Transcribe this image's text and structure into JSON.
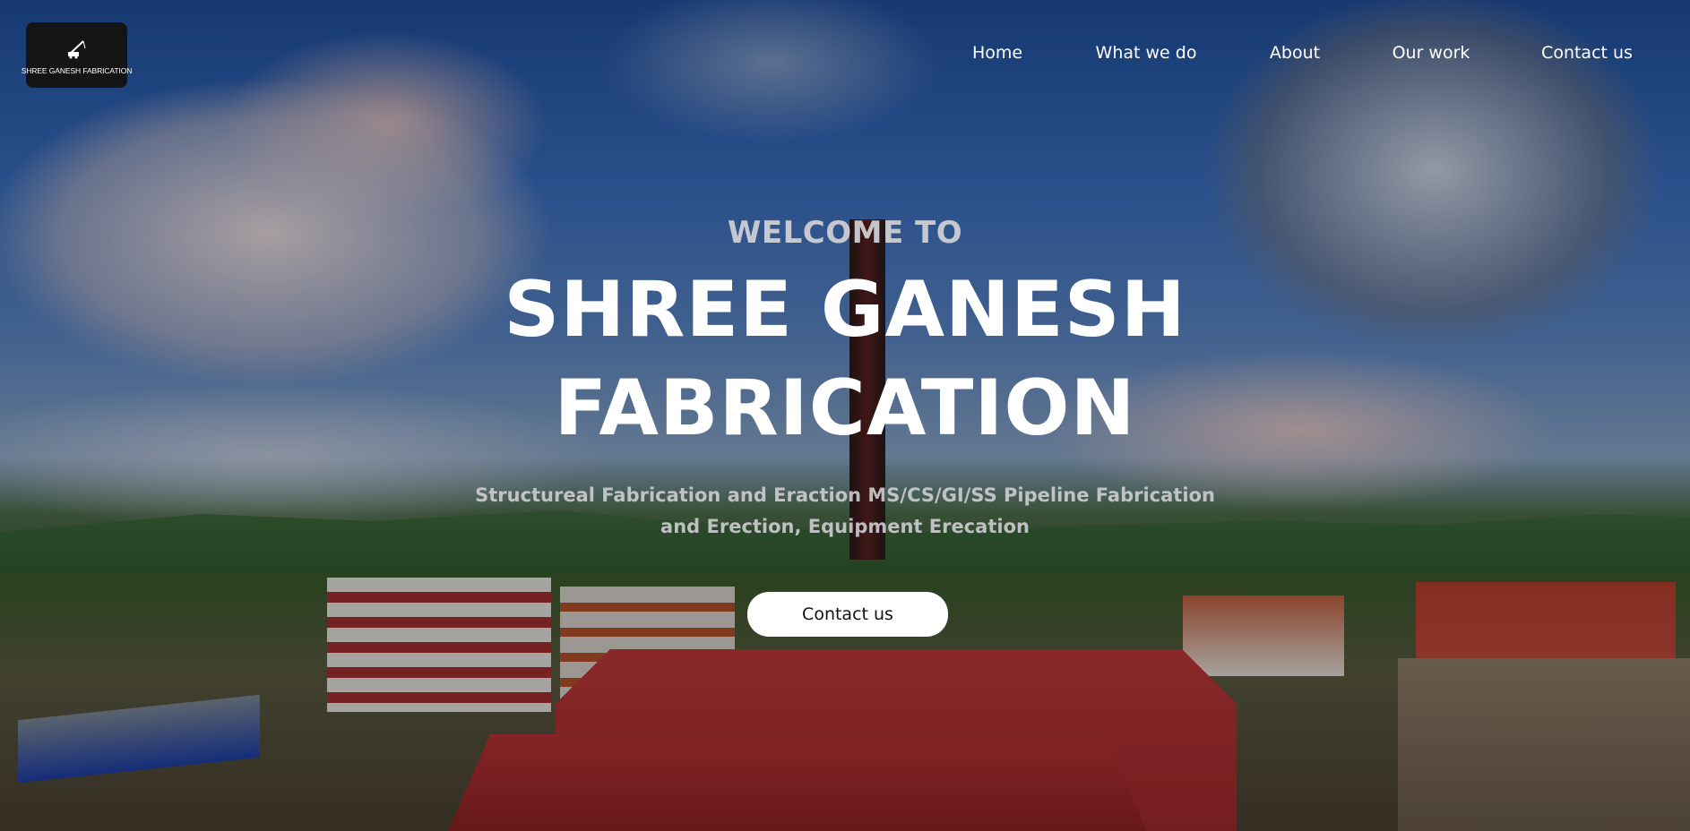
{
  "header": {
    "logo_text": "SHREE GANESH FABRICATION",
    "logo_icon": "crane-icon",
    "nav": [
      {
        "label": "Home"
      },
      {
        "label": "What we do"
      },
      {
        "label": "About"
      },
      {
        "label": "Our work"
      },
      {
        "label": "Contact us"
      }
    ]
  },
  "hero": {
    "welcome": "WELCOME TO",
    "title_line1": "SHREE GANESH",
    "title_line2": "FABRICATION",
    "subtitle": "Structureal Fabrication and Eraction MS/CS/GI/SS Pipeline Fabrication and Erection, Equipment Erecation",
    "cta_label": "Contact us"
  },
  "colors": {
    "text": "#ffffff",
    "logo_bg": "#141414",
    "cta_bg": "#ffffff",
    "cta_text": "#111111"
  }
}
